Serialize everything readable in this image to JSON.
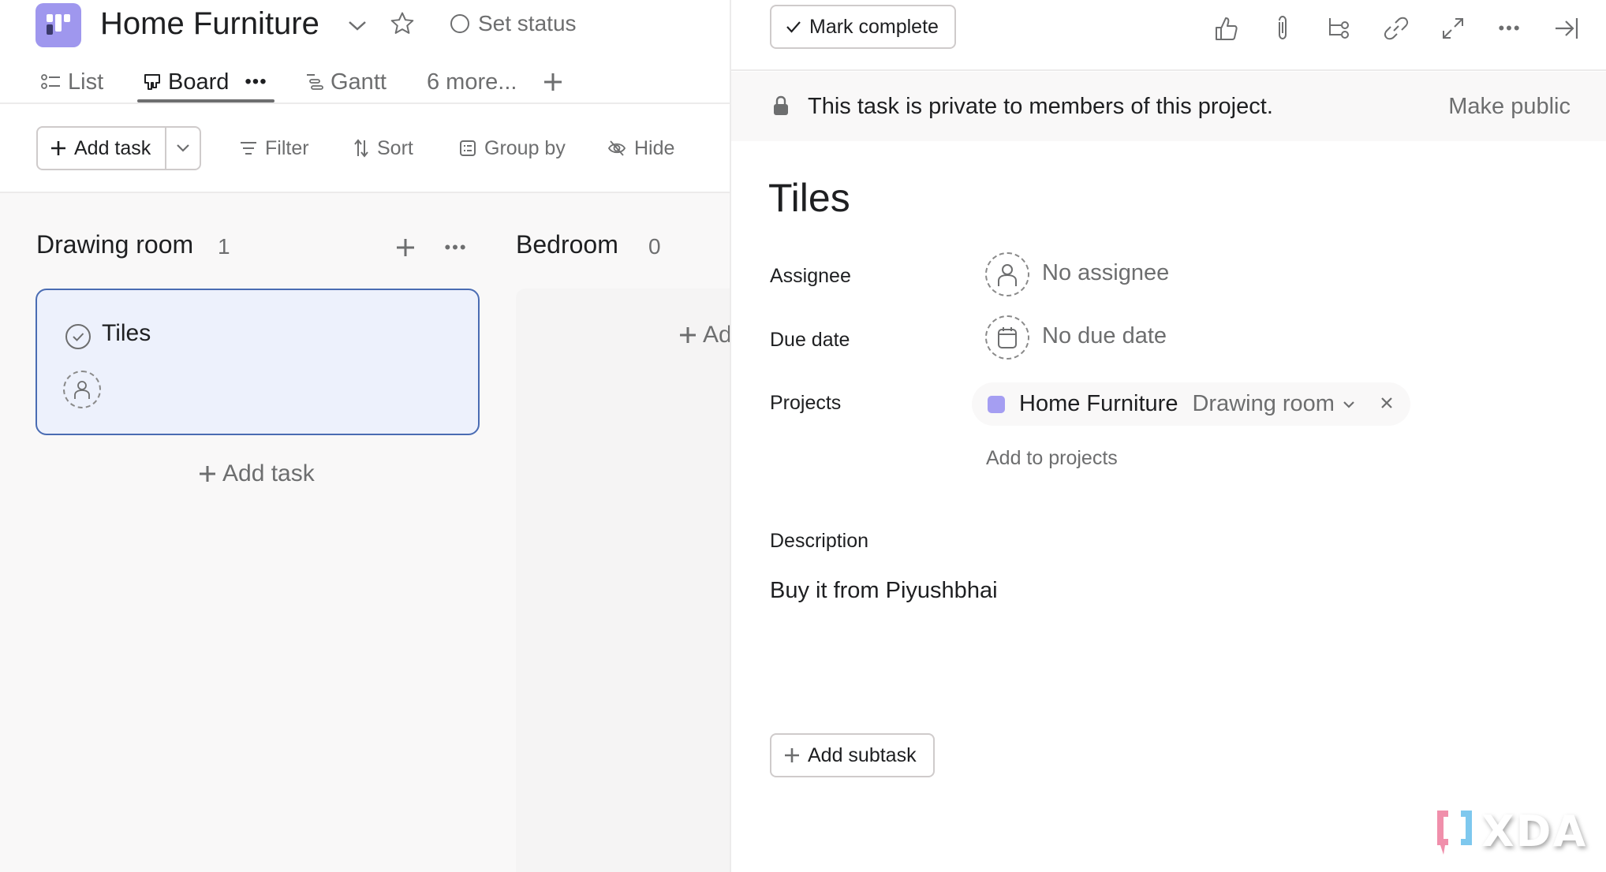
{
  "project": {
    "title": "Home Furniture",
    "set_status_label": "Set status",
    "logo_color": "#9f97ee"
  },
  "tabs": [
    {
      "label": "List",
      "icon": "list-icon",
      "active": false
    },
    {
      "label": "Board",
      "icon": "board-icon",
      "active": true
    },
    {
      "label": "Gantt",
      "icon": "gantt-icon",
      "active": false
    },
    {
      "label": "6 more...",
      "icon": null,
      "active": false
    }
  ],
  "toolbar": {
    "add_task_label": "Add task",
    "filter_label": "Filter",
    "sort_label": "Sort",
    "group_by_label": "Group by",
    "hide_label": "Hide"
  },
  "board": {
    "columns": [
      {
        "title": "Drawing room",
        "count": "1",
        "cards": [
          {
            "title": "Tiles"
          }
        ],
        "add_task_label": "Add task"
      },
      {
        "title": "Bedroom",
        "count": "0",
        "cards": [],
        "add_task_label": "Ad"
      }
    ]
  },
  "task_panel": {
    "mark_complete_label": "Mark complete",
    "toolbar_icons": [
      "thumbs-up-icon",
      "attachment-icon",
      "subtask-icon",
      "link-icon",
      "expand-icon",
      "more-icon",
      "close-panel-icon"
    ],
    "privacy_banner": "This task is private to members of this project.",
    "make_public_label": "Make public",
    "title": "Tiles",
    "fields": {
      "assignee_label": "Assignee",
      "assignee_value": "No assignee",
      "due_date_label": "Due date",
      "due_date_value": "No due date",
      "projects_label": "Projects",
      "project_name": "Home Furniture",
      "project_section": "Drawing room",
      "project_color": "#a59ef2",
      "add_to_projects_label": "Add to projects"
    },
    "description_label": "Description",
    "description_text": "Buy it from Piyushbhai",
    "add_subtask_label": "Add subtask"
  },
  "watermark": {
    "text": "XDA"
  }
}
